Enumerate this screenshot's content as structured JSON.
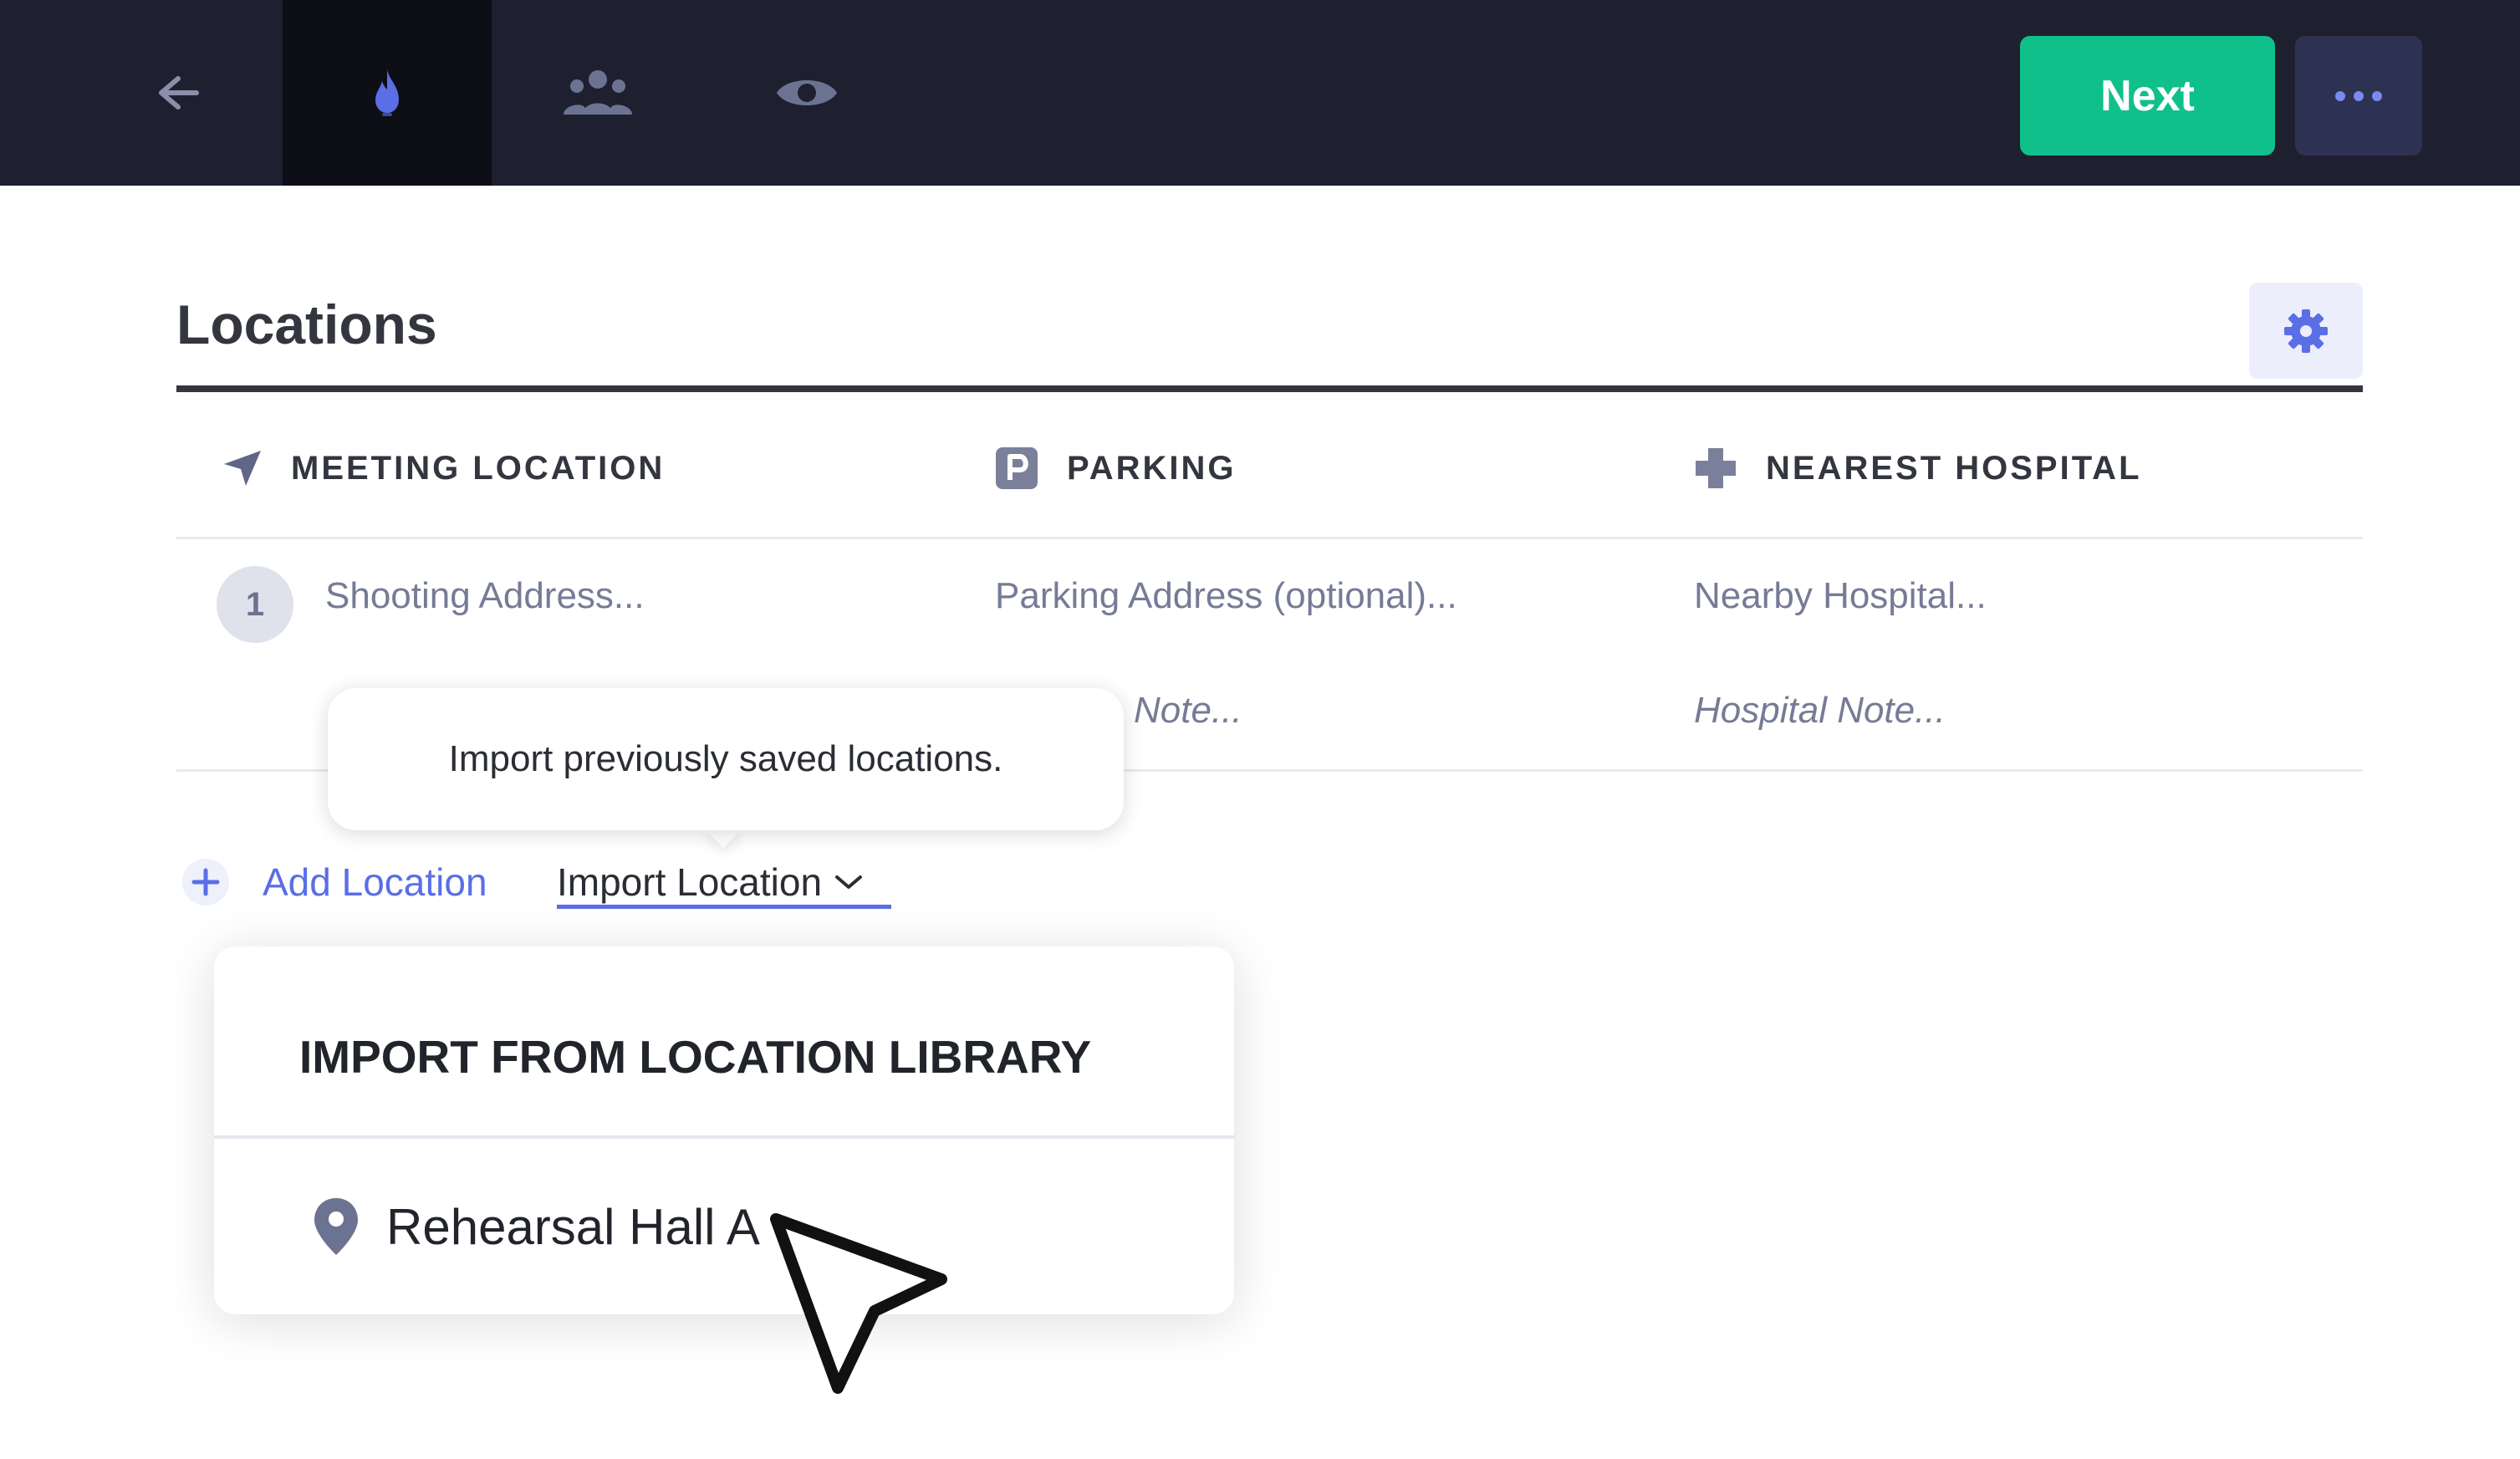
{
  "toolbar": {
    "icons": [
      "back-arrow-icon",
      "flame-icon",
      "team-icon",
      "eye-icon"
    ],
    "next_label": "Next",
    "more_icon": "ellipsis-icon",
    "colors": {
      "bar": "#1e2030",
      "next": "#10c08b",
      "accent": "#5a6ee6"
    }
  },
  "section": {
    "title": "Locations",
    "settings_icon": "gear-icon"
  },
  "columns": [
    {
      "label": "MEETING LOCATION",
      "icon": "navigation-arrow-icon"
    },
    {
      "label": "PARKING",
      "icon": "parking-icon"
    },
    {
      "label": "NEAREST HOSPITAL",
      "icon": "medical-cross-icon"
    }
  ],
  "rows": [
    {
      "number": "1",
      "meeting_placeholder": "Shooting Address...",
      "parking_placeholder": "Parking Address (optional)...",
      "parking_note": "Note...",
      "hospital_placeholder": "Nearby Hospital...",
      "hospital_note": "Hospital Note..."
    }
  ],
  "tooltip": {
    "text": "Import previously saved locations."
  },
  "actions": {
    "add_label": "Add Location",
    "import_label": "Import Location"
  },
  "dropdown": {
    "heading": "IMPORT FROM LOCATION LIBRARY",
    "items": [
      {
        "label": "Rehearsal Hall A",
        "icon": "map-pin-icon"
      }
    ]
  }
}
